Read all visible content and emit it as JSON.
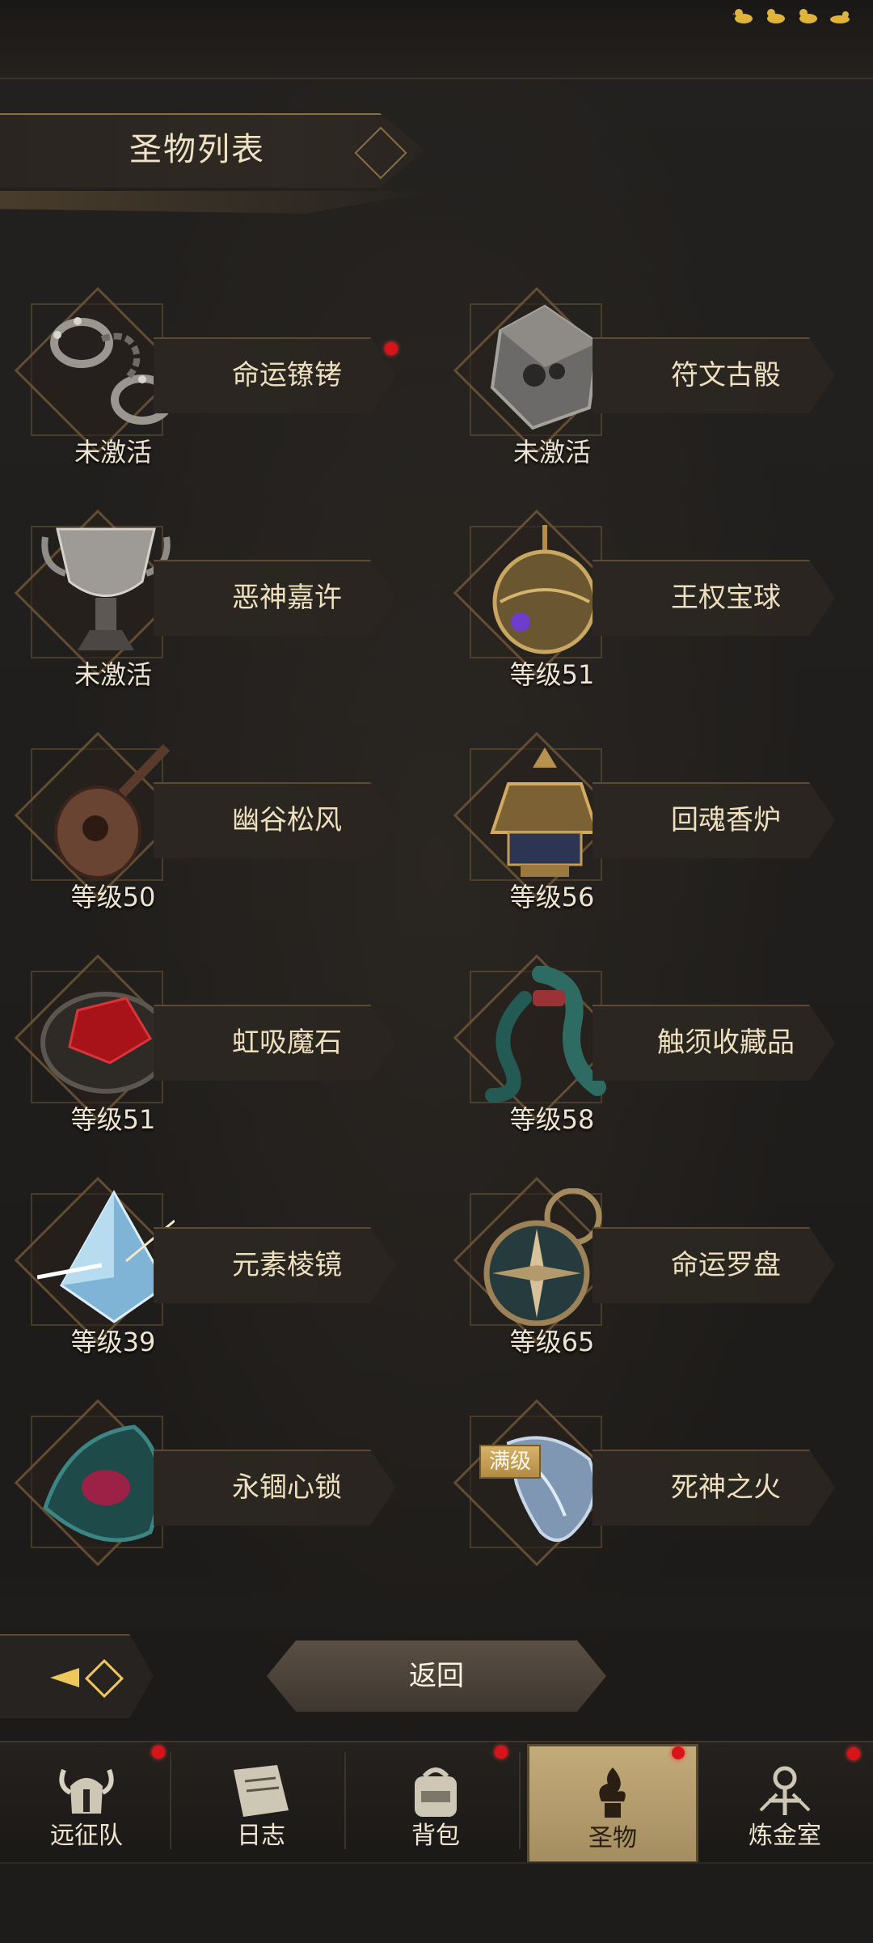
{
  "header": {
    "title": "圣物列表"
  },
  "relics": [
    {
      "name": "命运镣铐",
      "status": "未激活",
      "icon": "shackles-icon",
      "has_dot": true
    },
    {
      "name": "符文古骰",
      "status": "未激活",
      "icon": "rune-dice-icon",
      "has_dot": false
    },
    {
      "name": "恶神嘉许",
      "status": "未激活",
      "icon": "goblet-icon",
      "has_dot": false
    },
    {
      "name": "王权宝球",
      "status": "等级51",
      "icon": "royal-orb-icon",
      "has_dot": false
    },
    {
      "name": "幽谷松风",
      "status": "等级50",
      "icon": "lute-icon",
      "has_dot": false
    },
    {
      "name": "回魂香炉",
      "status": "等级56",
      "icon": "censer-icon",
      "has_dot": false
    },
    {
      "name": "虹吸魔石",
      "status": "等级51",
      "icon": "siphon-stone-icon",
      "has_dot": false
    },
    {
      "name": "触须收藏品",
      "status": "等级58",
      "icon": "tentacle-icon",
      "has_dot": false
    },
    {
      "name": "元素棱镜",
      "status": "等级39",
      "icon": "prism-icon",
      "has_dot": false
    },
    {
      "name": "命运罗盘",
      "status": "等级65",
      "icon": "compass-icon",
      "has_dot": false
    },
    {
      "name": "永锢心锁",
      "status": "",
      "icon": "heart-lock-icon",
      "has_dot": false
    },
    {
      "name": "死神之火",
      "status": "",
      "icon": "reaper-hand-icon",
      "has_dot": false,
      "badge": "满级"
    }
  ],
  "controls": {
    "return_label": "返回"
  },
  "tabs": [
    {
      "label": "远征队",
      "icon": "helmet-icon",
      "has_dot": true,
      "active": false
    },
    {
      "label": "日志",
      "icon": "journal-icon",
      "has_dot": false,
      "active": false
    },
    {
      "label": "背包",
      "icon": "backpack-icon",
      "has_dot": true,
      "active": false
    },
    {
      "label": "圣物",
      "icon": "relic-flame-icon",
      "has_dot": true,
      "active": true
    },
    {
      "label": "炼金室",
      "icon": "alchemy-icon",
      "has_dot": true,
      "active": false
    }
  ],
  "colors": {
    "accent": "#f0c85a",
    "notification": "#d8141a",
    "active_tab": "#b09a6b"
  }
}
